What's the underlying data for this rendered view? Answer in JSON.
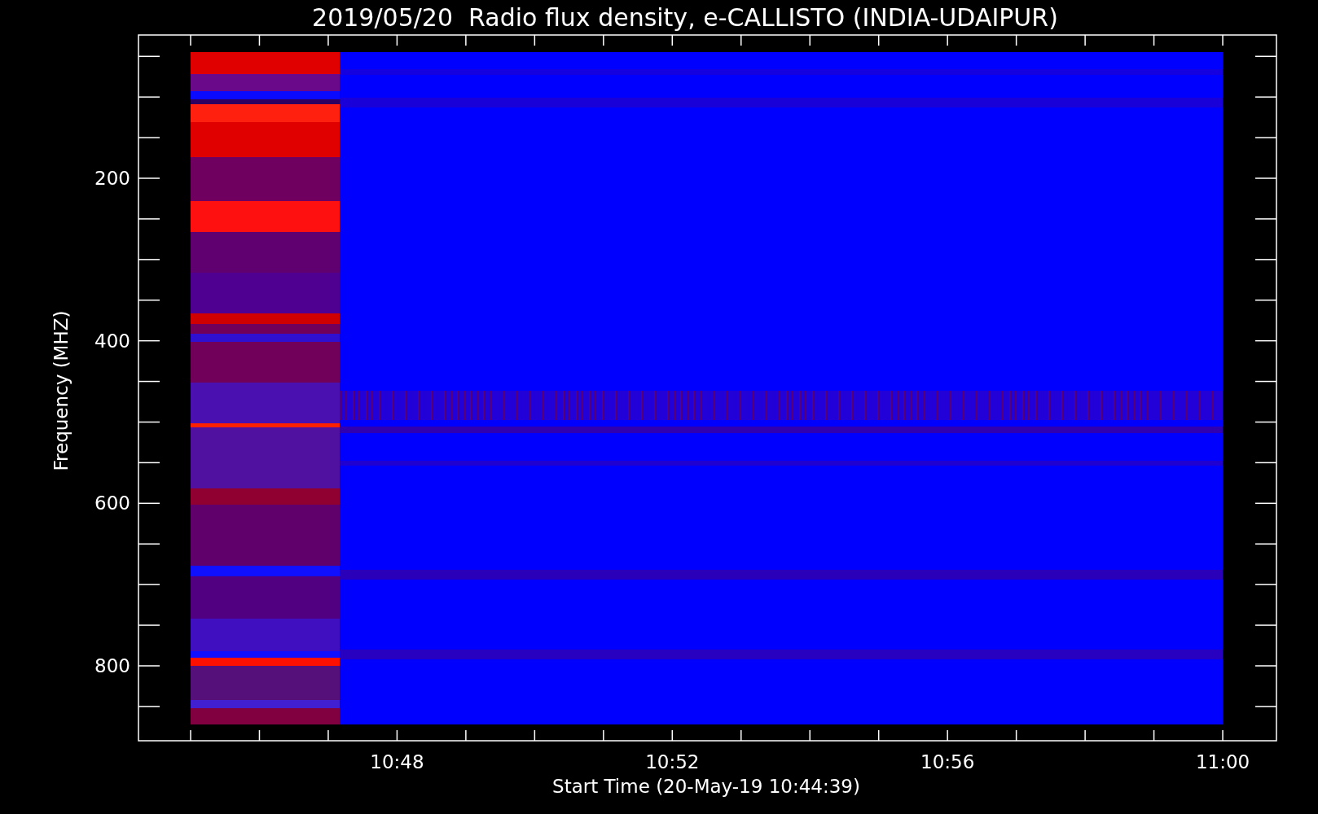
{
  "title": "2019/05/20  Radio flux density, e-CALLISTO (INDIA-UDAIPUR)",
  "y_axis": {
    "label": "Frequency (MHZ)",
    "ticks": [
      "200",
      "400",
      "600",
      "800"
    ]
  },
  "x_axis": {
    "label": "Start Time (20-May-19 10:44:39)",
    "ticks": [
      "10:48",
      "10:52",
      "10:56",
      "11:00"
    ]
  }
}
